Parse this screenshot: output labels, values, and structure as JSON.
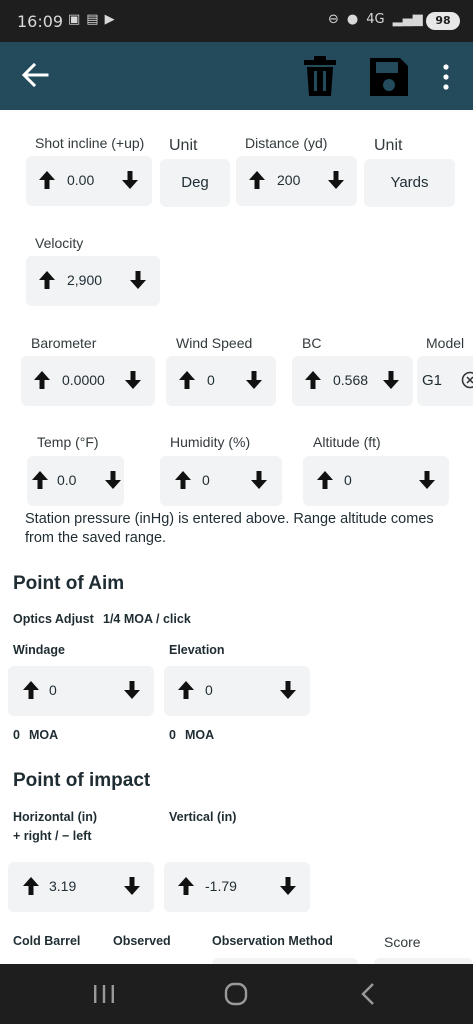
{
  "status_bar": {
    "time": "16:09",
    "network": "4G",
    "battery": "98"
  },
  "app_bar": {
    "icons": [
      "back-arrow-icon",
      "trash-icon",
      "save-icon",
      "more-vert-icon"
    ]
  },
  "shot": {
    "incline_label": "Shot incline (+up)",
    "incline_value": "0.00",
    "incline_unit_label": "Unit",
    "incline_unit_value": "Deg",
    "distance_label": "Distance (yd)",
    "distance_value": "200",
    "distance_unit_label": "Unit",
    "distance_unit_value": "Yards",
    "velocity_label": "Velocity",
    "velocity_value": "2,900"
  },
  "weather": {
    "barometer_label": "Barometer",
    "barometer_value": "0.0000",
    "wind_label": "Wind Speed",
    "wind_value": "0",
    "bc_label": "BC",
    "bc_value": "0.568",
    "model_label": "Model",
    "model_value": "G1",
    "temp_label": "Temp (°F)",
    "temp_value": "0.0",
    "humidity_label": "Humidity (%)",
    "humidity_value": "0",
    "altitude_label": "Altitude (ft)",
    "altitude_value": "0",
    "note": "Station pressure (inHg) is entered above. Range altitude comes from the saved range."
  },
  "aim": {
    "title": "Point of Aim",
    "optics_label": "Optics Adjust",
    "optics_value": "1/4 MOA / click",
    "windage_label": "Windage",
    "windage_value": "0",
    "windage_moa": "0",
    "elevation_label": "Elevation",
    "elevation_value": "0",
    "elevation_moa": "0",
    "moa_unit": "MOA"
  },
  "impact": {
    "title": "Point of impact",
    "horizontal_label": "Horizontal (in)",
    "horizontal_hint": "+ right / − left",
    "horizontal_value": "3.19",
    "vertical_label": "Vertical (in)",
    "vertical_value": "-1.79"
  },
  "bottom_row": {
    "cold_barrel_label": "Cold Barrel",
    "observed_label": "Observed",
    "method_label": "Observation Method",
    "score_label": "Score"
  },
  "colors": {
    "app_bar": "#234b5c",
    "field_bg": "#f1f3f4",
    "status_bar": "#1e1e1e"
  }
}
